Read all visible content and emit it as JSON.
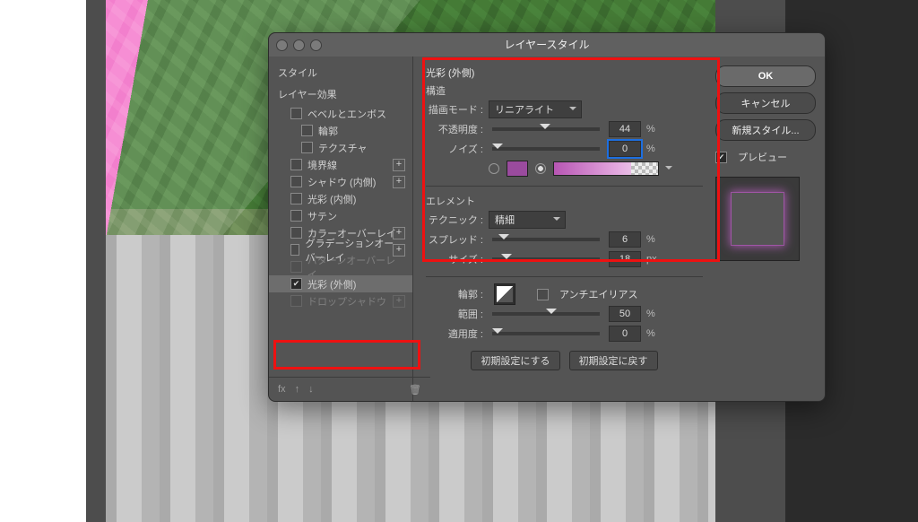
{
  "dialog": {
    "title": "レイヤースタイル",
    "ok": "OK",
    "cancel": "キャンセル",
    "newStyle": "新規スタイル...",
    "preview": "プレビュー"
  },
  "styles": {
    "header": "スタイル",
    "layerEffects": "レイヤー効果",
    "items": [
      {
        "label": "ベベルとエンボス",
        "checked": false,
        "indent": 1
      },
      {
        "label": "輪郭",
        "checked": false,
        "indent": 2
      },
      {
        "label": "テクスチャ",
        "checked": false,
        "indent": 2
      },
      {
        "label": "境界線",
        "checked": false,
        "indent": 1,
        "plus": true
      },
      {
        "label": "シャドウ (内側)",
        "checked": false,
        "indent": 1,
        "plus": true
      },
      {
        "label": "光彩 (内側)",
        "checked": false,
        "indent": 1
      },
      {
        "label": "サテン",
        "checked": false,
        "indent": 1
      },
      {
        "label": "カラーオーバーレイ",
        "checked": false,
        "indent": 1,
        "plus": true
      },
      {
        "label": "グラデーションオーバーレイ",
        "checked": false,
        "indent": 1,
        "plus": true
      },
      {
        "label": "パターンオーバーレイ",
        "checked": false,
        "indent": 1
      },
      {
        "label": "光彩 (外側)",
        "checked": true,
        "indent": 1,
        "selected": true
      },
      {
        "label": "ドロップシャドウ",
        "checked": false,
        "indent": 1,
        "plus": true
      }
    ],
    "footer_fx": "fx"
  },
  "glow": {
    "title": "光彩 (外側)",
    "structure": "構造",
    "blendModeLabel": "描画モード :",
    "blendMode": "リニアライト",
    "opacityLabel": "不透明度 :",
    "opacity": "44",
    "noiseLabel": "ノイズ :",
    "noise": "0",
    "percent": "%",
    "elements": "エレメント",
    "techniqueLabel": "テクニック :",
    "technique": "精細",
    "spreadLabel": "スプレッド :",
    "spread": "6",
    "sizeLabel": "サイズ :",
    "size": "18",
    "px": "px",
    "contourLabel": "輪郭 :",
    "antiAlias": "アンチエイリアス",
    "rangeLabel": "範囲 :",
    "range": "50",
    "jitterLabel": "適用度 :",
    "jitter": "0",
    "resetDefault": "初期設定にする",
    "revertDefault": "初期設定に戻す"
  }
}
